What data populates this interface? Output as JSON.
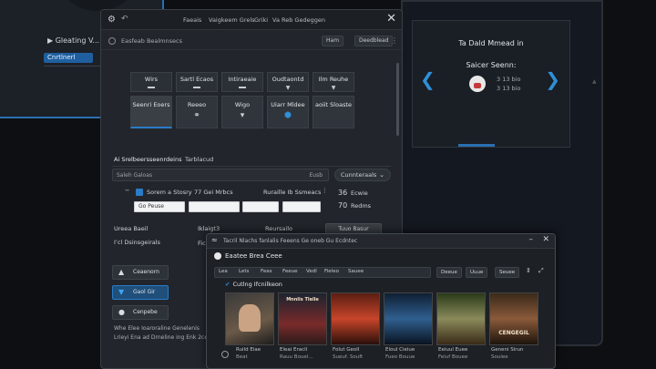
{
  "bg_left": {
    "title": "▶ Gleating V...",
    "button": "Cnrtlnerl"
  },
  "bg_right": {
    "title": "Ta Dald Mmead in",
    "subtitle": "Saicer Seenn:",
    "meta1": "3 13 bio",
    "meta2": "3 13 bio"
  },
  "main": {
    "tabs": [
      "Faeais",
      "Vaigkeem Grels",
      "Griki",
      "Va Reb Gedeggen"
    ],
    "toolbar_label": "Easfeab Bealmnsecs",
    "toolbar_btn1": "Ham",
    "toolbar_btn2": "Deedblead",
    "tiles_head": [
      "Wirs",
      "Sartl Ecaos",
      "Intiraeaie",
      "Oudtaontd",
      "Ilm Reuhe"
    ],
    "tiles_body": [
      "Seenri Eoers",
      "Reeeo",
      "Wigo",
      "Uiarr Mldee",
      "aoiit Sloaste"
    ],
    "section_tabs": [
      "Ai Srelbeersseenrdeins",
      "Tarblacud"
    ],
    "search_placeholder": "Saleh Galoas",
    "search_small": "Eusb",
    "dropdown": "Cunnteraals",
    "form_row_label": "Sorem a Stosry",
    "form_row_label2": "77 Gei Mrbcs",
    "form_row_label3": "Ruraille Ib Ssmeacs",
    "form_val1": "36",
    "form_val1_label": "Ecwie",
    "form_input": "Go Peuse",
    "form_val2": "70",
    "form_val2_label": "Redms",
    "left_lbl1": "Ureea Baeil",
    "left_lbl2": "I’cl Dsinsgeirals",
    "mid_lbl1": "Iklaigt3",
    "mid_lbl2": "Ficlessie",
    "mid_lbl3": "Reursailo",
    "right_btn": "Tuuo Basur",
    "side_btns": [
      "Ceaenorn",
      "Gaol Gir",
      "Cenpebe"
    ],
    "footnote1": "Whe Elee Ioaroraline Genelenis",
    "footnote2": "Lrieyi Ena ad Drneline ing Enk 2cenlis."
  },
  "overlay": {
    "title": "Tacril Nlachs fanlalis Feeens Ge oneb Gu Ecdntec",
    "heading": "Eaatee Brea Ceee",
    "tabs": [
      "Lea",
      "Lets",
      "Feas",
      "Feeue",
      "Vedl",
      "Fieleo",
      "Sauee"
    ],
    "btn1": "Deeue",
    "btn2": "Uuue",
    "btn3": "Seuee",
    "section": "Cutlng Ifcnilkeon",
    "posters": [
      {
        "caption": "Ruild Eiae",
        "sub": "Beat",
        "text": ""
      },
      {
        "caption": "Eleai Eracll",
        "sub": "Rauu Bouel...",
        "text": "Mnnlis Tlelle"
      },
      {
        "caption": "Folut Geoll",
        "sub": "Sueuf. Souft",
        "text": ""
      },
      {
        "caption": "Eloul Cieiue",
        "sub": "Fueo Bouue",
        "text": ""
      },
      {
        "caption": "Eeiuul Euee",
        "sub": "Feiuf Bouee",
        "text": ""
      },
      {
        "caption": "Geneni Sirun",
        "sub": "Soulee",
        "text": "CENGEGIL"
      }
    ]
  }
}
